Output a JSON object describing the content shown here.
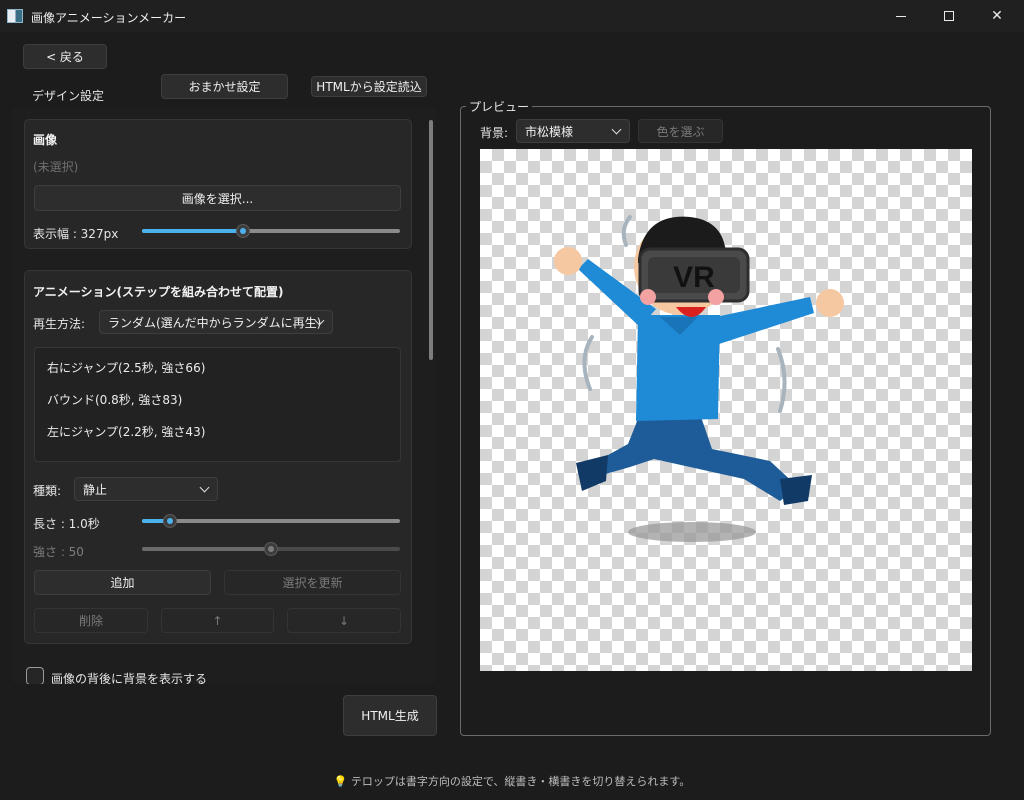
{
  "window": {
    "title": "画像アニメーションメーカー",
    "minimize_label": "",
    "maximize_label": "",
    "close_label": "✕"
  },
  "nav": {
    "back_label": "< 戻る"
  },
  "tabs": {
    "design_label": "デザイン設定",
    "auto_label": "おまかせ設定",
    "html_import_label": "HTMLから設定読込"
  },
  "image_group": {
    "title": "画像",
    "selected_file": "(未選択)",
    "select_button": "画像を選択...",
    "width_label": "表示幅 : 327px",
    "width_fraction": 0.39
  },
  "animation_group": {
    "title": "アニメーション(ステップを組み合わせて配置)",
    "play_mode_label": "再生方法:",
    "play_mode_value": "ランダム(選んだ中からランダムに再生)",
    "steps": [
      "右にジャンプ(2.5秒, 強さ66)",
      "バウンド(0.8秒, 強さ83)",
      "左にジャンプ(2.2秒, 強さ43)"
    ],
    "type_label": "種類:",
    "type_value": "静止",
    "length_label": "長さ : 1.0秒",
    "length_fraction": 0.11,
    "strength_label": "強さ : 50",
    "strength_fraction": 0.5,
    "add_button": "追加",
    "update_button": "選択を更新",
    "delete_button": "削除",
    "up_button": "↑",
    "down_button": "↓"
  },
  "background_checkbox": {
    "label": "画像の背後に背景を表示する",
    "checked": false
  },
  "generate_button": "HTML生成",
  "preview": {
    "legend": "プレビュー",
    "bg_label": "背景:",
    "bg_value": "市松模様",
    "color_button": "色を選ぶ",
    "vr_text": "VR"
  },
  "hint": {
    "icon": "💡",
    "text": "テロップは書字方向の設定で、縦書き・横書きを切り替えられます。"
  },
  "colors": {
    "accent": "#4cb2ee",
    "background": "#1c1c1c",
    "shirt": "#1f8ad6",
    "pants": "#1d5b99"
  }
}
